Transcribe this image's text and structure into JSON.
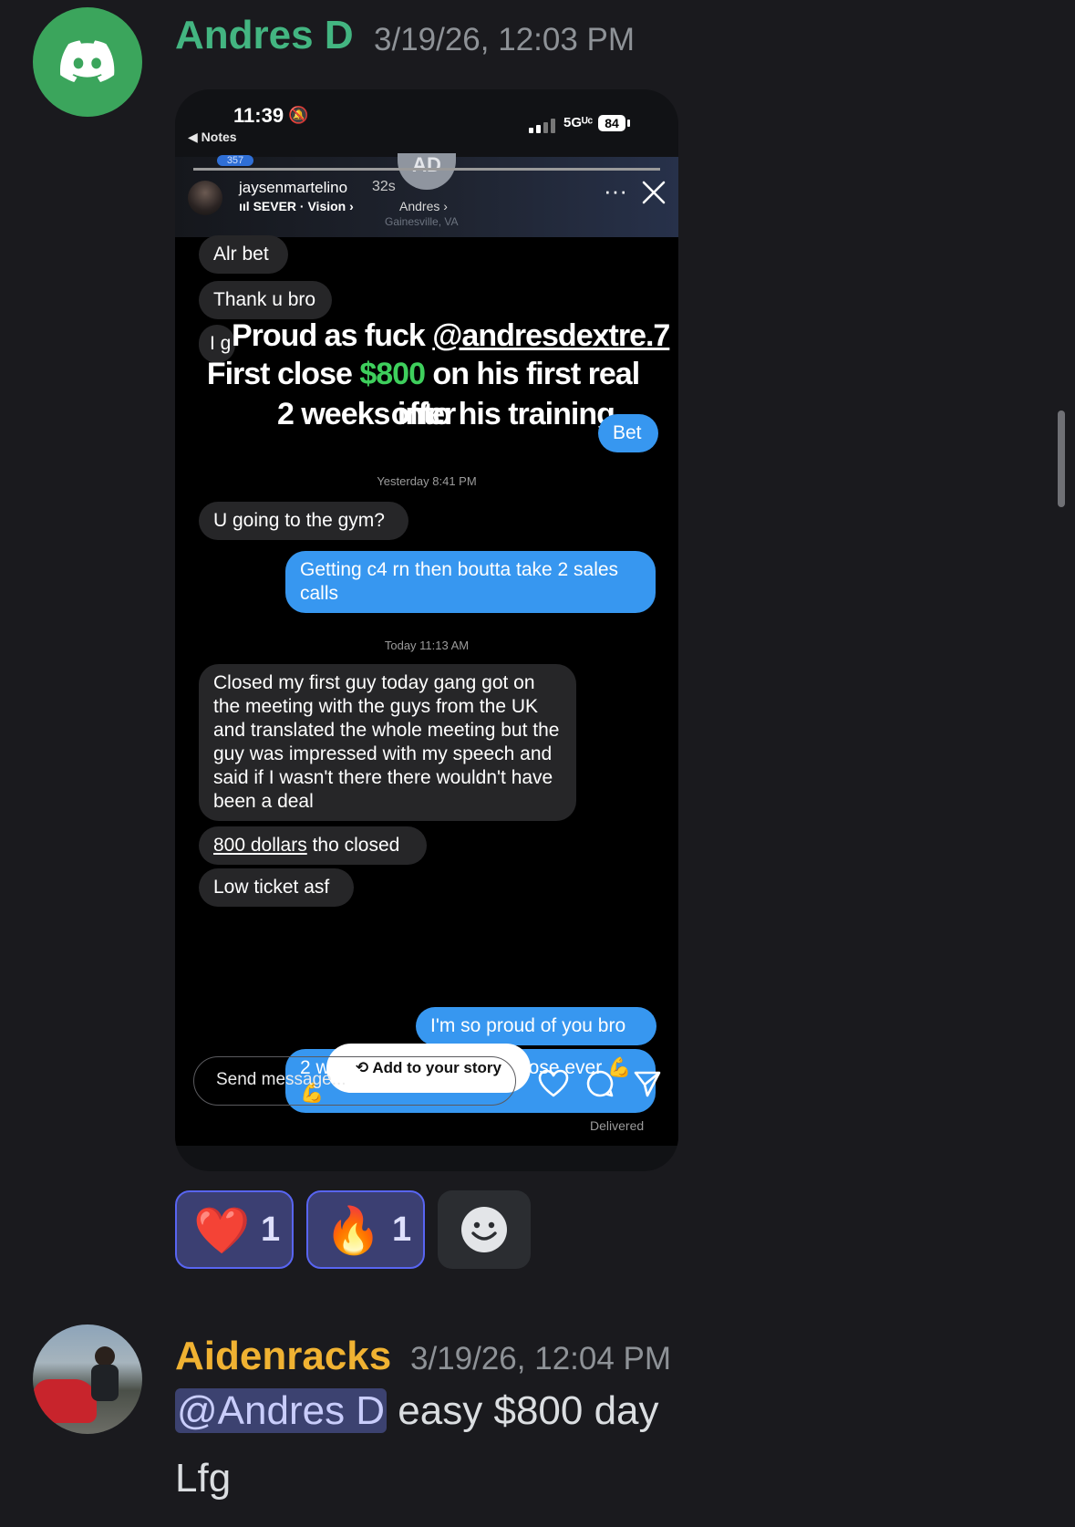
{
  "message1": {
    "author": "Andres D",
    "timestamp": "3/19/26, 12:03 PM",
    "avatar_icon": "discord-logo-icon",
    "author_color": "#43b581",
    "reactions": [
      {
        "emoji": "❤️",
        "count": "1"
      },
      {
        "emoji": "🔥",
        "count": "1"
      }
    ],
    "add_reaction_icon": "smiley-face-icon"
  },
  "screenshot": {
    "status": {
      "time": "11:39",
      "back_label": "◀ Notes",
      "network": "5Gᵁᶜ",
      "battery": "84"
    },
    "story": {
      "badge": "357",
      "circle_initials": "AD",
      "username": "jaysenmartelino",
      "age": "32s",
      "music": "SEVER · Vision ›",
      "mention": "Andres ›",
      "location": "Gainesville, VA"
    },
    "overlay": {
      "line1_prefix": "Proud as fuck ",
      "line1_handle": "@andresdextre.7",
      "line2_prefix": "First close ",
      "line2_money": "$800",
      "line2_suffix": " on his first real offer",
      "line3": "2 weeks into his training"
    },
    "messages": {
      "m1": "Alr bet",
      "m2": "Thank u bro",
      "m3_peek": "I g",
      "m4_out": "Bet",
      "stamp1": "Yesterday 8:41 PM",
      "m5": "U going to the gym?",
      "m6_out": "Getting c4 rn then boutta take 2 sales calls",
      "stamp2": "Today 11:13 AM",
      "m7": "Closed my first guy today gang got on the meeting with the guys from the UK and translated the whole meeting but the guy was impressed with my speech and said if I wasn't there there wouldn't have been a deal",
      "m8_link": "800 dollars",
      "m8_rest": " tho closed",
      "m9": "Low ticket asf",
      "m10_out": "I'm so proud of you bro",
      "m11_out_left": "2 w",
      "m11_out_right": "lose ever 💪",
      "m11_out_line2": "💪",
      "delivered": "Delivered"
    },
    "add_story_label": "Add to your story",
    "send_placeholder": "Send message..."
  },
  "message2": {
    "author": "Aidenracks",
    "timestamp": "3/19/26, 12:04 PM",
    "author_color": "#f0b232",
    "mention": "@Andres D",
    "text_line1": " easy $800 day",
    "text_line2": "Lfg"
  }
}
